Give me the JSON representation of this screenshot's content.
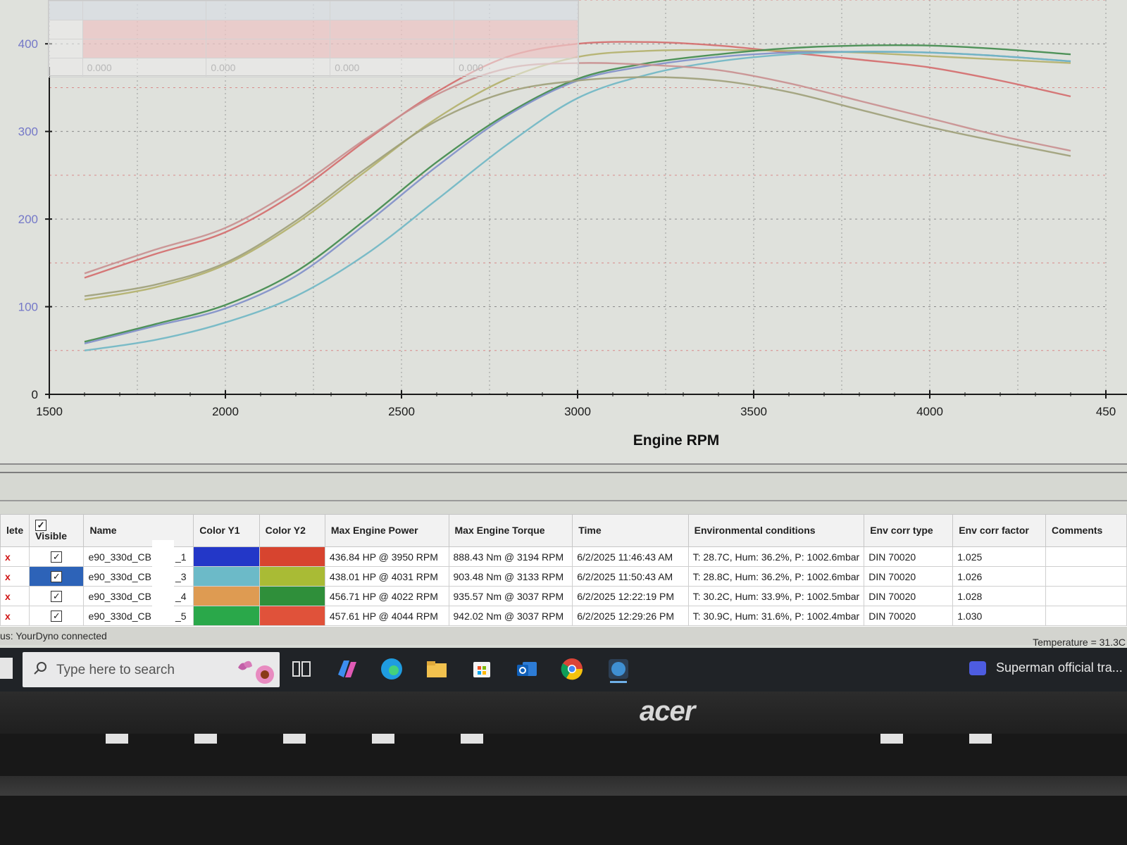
{
  "chart_data": {
    "type": "line",
    "xlabel": "Engine RPM",
    "ylabel": "",
    "xlim": [
      1500,
      4500
    ],
    "ylim": [
      0,
      450
    ],
    "x_ticks": [
      "1500",
      "2000",
      "2500",
      "3000",
      "3500",
      "4000",
      "450"
    ],
    "y_ticks": [
      "0",
      "100",
      "200",
      "300",
      "400"
    ],
    "grid": true,
    "x": [
      1600,
      1800,
      2000,
      2200,
      2400,
      2600,
      2800,
      3000,
      3200,
      3400,
      3600,
      3800,
      4000,
      4200,
      4400
    ],
    "series": [
      {
        "color": "#d46c6c",
        "values": [
          133,
          160,
          185,
          230,
          290,
          345,
          385,
          400,
          402,
          398,
          390,
          382,
          373,
          358,
          340
        ]
      },
      {
        "color": "#b2b06a",
        "values": [
          108,
          122,
          148,
          195,
          255,
          315,
          360,
          385,
          392,
          393,
          392,
          390,
          386,
          382,
          378
        ]
      },
      {
        "color": "#3f8a4a",
        "values": [
          60,
          80,
          102,
          140,
          200,
          265,
          320,
          360,
          378,
          388,
          395,
          398,
          398,
          394,
          388
        ]
      },
      {
        "color": "#7f8fc9",
        "values": [
          58,
          78,
          98,
          135,
          195,
          260,
          318,
          358,
          375,
          385,
          390,
          391,
          390,
          386,
          380
        ]
      },
      {
        "color": "#6fb7c4",
        "values": [
          50,
          62,
          82,
          112,
          160,
          222,
          285,
          338,
          365,
          380,
          388,
          391,
          390,
          386,
          380
        ]
      },
      {
        "color": "#c98f8f",
        "values": [
          138,
          165,
          190,
          235,
          292,
          342,
          372,
          378,
          376,
          370,
          355,
          335,
          315,
          295,
          278
        ]
      },
      {
        "color": "#9ea079",
        "values": [
          112,
          125,
          150,
          198,
          258,
          312,
          345,
          358,
          362,
          358,
          345,
          325,
          305,
          288,
          272
        ]
      }
    ]
  },
  "overlay": {
    "rows": [
      {
        "label": "",
        "c1": "",
        "c2": "",
        "c3": "",
        "c4": ""
      },
      {
        "label": "",
        "c1": "",
        "c2": "",
        "c3": "",
        "c4": ""
      },
      {
        "label": "",
        "c1": "",
        "c2": "",
        "c3": "",
        "c4": ""
      },
      {
        "label": "",
        "c1": "0.000",
        "c2": "0.000",
        "c3": "0.000",
        "c4": "0.000"
      }
    ]
  },
  "runs": {
    "headers": {
      "delete": "lete",
      "visible": "Visible",
      "name": "Name",
      "color_y1": "Color Y1",
      "color_y2": "Color Y2",
      "max_power": "Max Engine Power",
      "max_torque": "Max Engine Torque",
      "time": "Time",
      "env": "Environmental conditions",
      "env_type": "Env corr type",
      "env_factor": "Env corr factor",
      "comments": "Comments"
    },
    "rows": [
      {
        "name": "e90_330d_CB",
        "suffix": "_1",
        "y1": "#2337c8",
        "y2": "#d7442f",
        "power": "436.84 HP @ 3950 RPM",
        "torque": "888.43 Nm @ 3194 RPM",
        "time": "6/2/2025 11:46:43 AM",
        "env": "T: 28.7C, Hum: 36.2%, P: 1002.6mbar",
        "type": "DIN 70020",
        "factor": "1.025",
        "comments": ""
      },
      {
        "name": "e90_330d_CB",
        "suffix": "_3",
        "y1": "#6cbac8",
        "y2": "#a9bb35",
        "power": "438.01 HP @ 4031 RPM",
        "torque": "903.48 Nm @ 3133 RPM",
        "time": "6/2/2025 11:50:43 AM",
        "env": "T: 28.8C, Hum: 36.2%, P: 1002.6mbar",
        "type": "DIN 70020",
        "factor": "1.026",
        "comments": ""
      },
      {
        "name": "e90_330d_CB",
        "suffix": "_4",
        "y1": "#de9b52",
        "y2": "#2f8f3a",
        "power": "456.71 HP @ 4022 RPM",
        "torque": "935.57 Nm @ 3037 RPM",
        "time": "6/2/2025 12:22:19 PM",
        "env": "T: 30.2C, Hum: 33.9%, P: 1002.5mbar",
        "type": "DIN 70020",
        "factor": "1.028",
        "comments": ""
      },
      {
        "name": "e90_330d_CB",
        "suffix": "_5",
        "y1": "#2aa84a",
        "y2": "#e0523a",
        "power": "457.61 HP @ 4044 RPM",
        "torque": "942.02 Nm @ 3037 RPM",
        "time": "6/2/2025 12:29:26 PM",
        "env": "T: 30.9C, Hum: 31.6%, P: 1002.4mbar",
        "type": "DIN 70020",
        "factor": "1.030",
        "comments": ""
      }
    ],
    "delete_glyph": "x",
    "check_glyph": "✓"
  },
  "status": {
    "left": "us: YourDyno connected",
    "right": "Temperature = 31.3C"
  },
  "taskbar": {
    "search_placeholder": "Type here to search",
    "media_title": "Superman official tra...",
    "icons": [
      "task-view-icon",
      "copilot-icon",
      "edge-icon",
      "file-explorer-icon",
      "store-icon",
      "outlook-icon",
      "chrome-icon",
      "dyno-app-icon"
    ]
  },
  "monitor": {
    "brand": "acer"
  }
}
